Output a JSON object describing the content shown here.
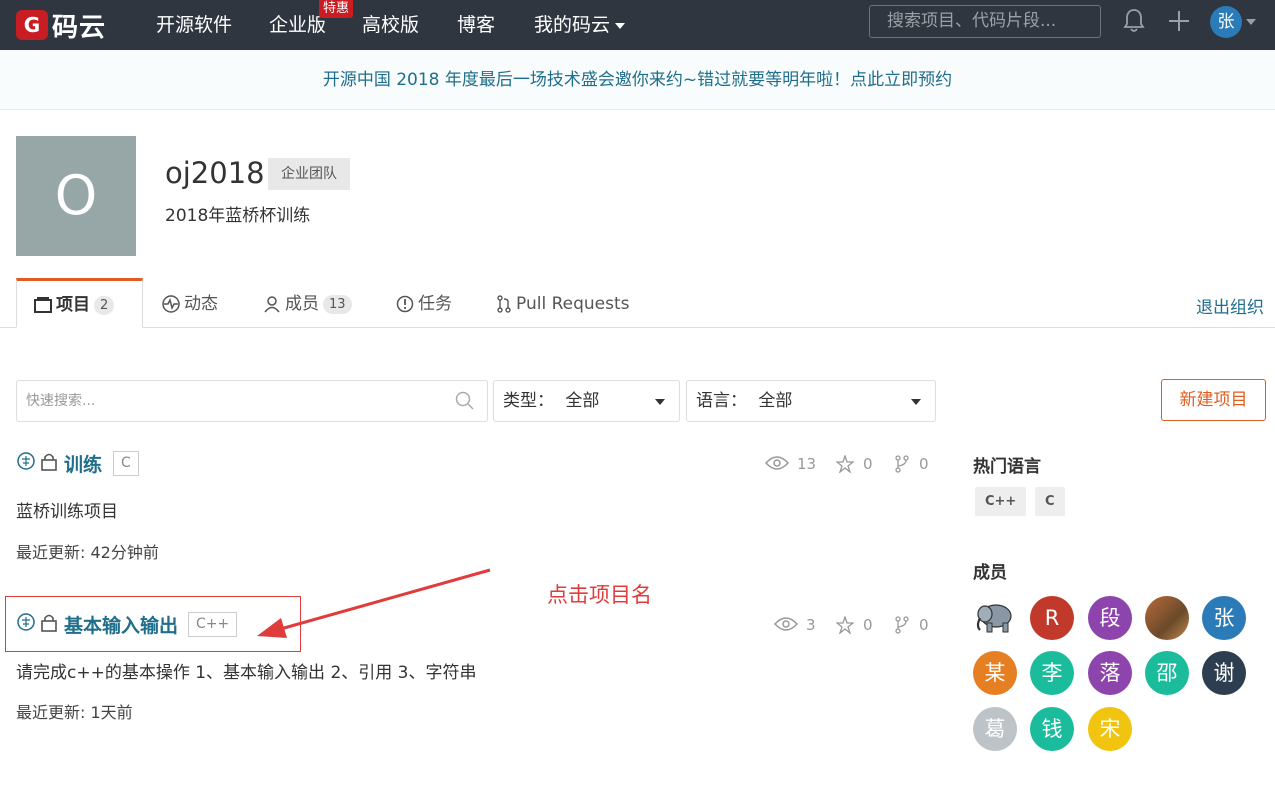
{
  "header": {
    "logo_letter": "G",
    "logo_text": "码云",
    "nav": [
      {
        "label": "开源软件"
      },
      {
        "label": "企业版"
      },
      {
        "label": "高校版"
      },
      {
        "label": "博客"
      },
      {
        "label": "我的码云"
      }
    ],
    "special_badge": "特惠",
    "search_placeholder": "搜索项目、代码片段...",
    "user_initial": "张"
  },
  "banner": {
    "text": "开源中国 2018 年度最后一场技术盛会邀你来约~错过就要等明年啦！点此立即预约"
  },
  "team": {
    "avatar_letter": "O",
    "name": "oj2018",
    "tag": "企业团队",
    "description": "2018年蓝桥杯训练"
  },
  "tabs": [
    {
      "label": "项目",
      "count": "2",
      "icon": "folder-icon"
    },
    {
      "label": "动态",
      "icon": "activity-icon"
    },
    {
      "label": "成员",
      "count": "13",
      "icon": "user-icon"
    },
    {
      "label": "任务",
      "icon": "issue-icon"
    },
    {
      "label": "Pull Requests",
      "icon": "pull-request-icon"
    }
  ],
  "quit_label": "退出组织",
  "filters": {
    "search_placeholder": "快速搜索...",
    "type_label": "类型：",
    "type_value": "全部",
    "lang_label": "语言：",
    "lang_value": "全部",
    "new_button": "新建项目"
  },
  "projects": [
    {
      "name": "训练",
      "lang": "C",
      "views": "13",
      "stars": "0",
      "forks": "0",
      "description": "蓝桥训练项目",
      "updated": "最近更新: 42分钟前"
    },
    {
      "name": "基本输入输出",
      "lang": "C++",
      "views": "3",
      "stars": "0",
      "forks": "0",
      "description": "请完成c++的基本操作 1、基本输入输出 2、引用 3、字符串",
      "updated": "最近更新: 1天前"
    }
  ],
  "annotation": {
    "text": "点击项目名",
    "color": "#e03c3c"
  },
  "sidebar": {
    "hot_lang_title": "热门语言",
    "hot_langs": [
      "C++",
      "C"
    ],
    "members_title": "成员",
    "members": [
      {
        "initial": "",
        "color": "#ffffff",
        "icon": "elephant-icon"
      },
      {
        "initial": "R",
        "color": "#c0392b"
      },
      {
        "initial": "段",
        "color": "#8e44ad"
      },
      {
        "initial": "",
        "color": "#a0522d",
        "icon": "photo-avatar"
      },
      {
        "initial": "张",
        "color": "#2b7bb9"
      },
      {
        "initial": "某",
        "color": "#e67e22"
      },
      {
        "initial": "李",
        "color": "#1abc9c"
      },
      {
        "initial": "落",
        "color": "#8e44ad"
      },
      {
        "initial": "邵",
        "color": "#1abc9c"
      },
      {
        "initial": "谢",
        "color": "#2c3e50"
      },
      {
        "initial": "葛",
        "color": "#bdc3c7"
      },
      {
        "initial": "钱",
        "color": "#1abc9c"
      },
      {
        "initial": "宋",
        "color": "#f1c40f"
      }
    ]
  },
  "colors": {
    "accent": "#e05d1f",
    "link": "#1f6e8c",
    "header_bg": "#2f3640",
    "brand_red": "#c71d23"
  }
}
